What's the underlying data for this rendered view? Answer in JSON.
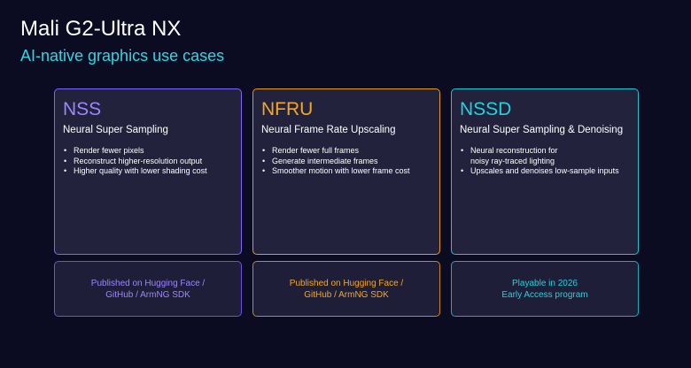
{
  "title": "Mali G2-Ultra NX",
  "subtitle": "AI-native graphics use cases",
  "colors": {
    "background": "#0b0b22",
    "subtitle": "#33d6e0",
    "nss": "#9d86ff",
    "nfru": "#f5a623",
    "nssd": "#22d3dd"
  },
  "cards": [
    {
      "name": "NSS",
      "full_name": "Neural Super Sampling",
      "bullets": [
        "Render fewer pixels",
        "Reconstruct higher-resolution output",
        "Higher quality with lower shading cost"
      ],
      "footer": [
        "Published on Hugging Face /",
        "GitHub / ArmNG SDK"
      ]
    },
    {
      "name": "NFRU",
      "full_name": "Neural Frame Rate Upscaling",
      "bullets": [
        "Render fewer full frames",
        "Generate intermediate frames",
        "Smoother motion with lower frame cost"
      ],
      "footer": [
        "Published on Hugging Face /",
        "GitHub / ArmNG SDK"
      ]
    },
    {
      "name": "NSSD",
      "full_name": "Neural Super Sampling & Denoising",
      "bullets": [
        "Neural reconstruction for noisy ray-traced lighting",
        "Upscales and denoises low-sample inputs"
      ],
      "footer": [
        "Playable in 2026",
        "Early Access program"
      ]
    }
  ]
}
